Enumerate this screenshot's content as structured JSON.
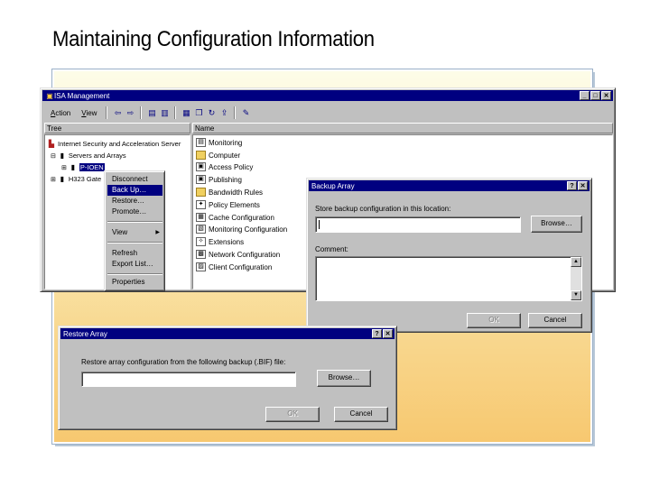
{
  "slide": {
    "title": "Maintaining Configuration Information"
  },
  "isa_window": {
    "title": "ISA Management",
    "menu": [
      {
        "first": "A",
        "rest": "ction"
      },
      {
        "first": "V",
        "rest": "iew"
      }
    ],
    "tree_header": "Tree",
    "tree": [
      {
        "label": "Internet Security and Acceleration Server",
        "icon": "isa-server-icon"
      },
      {
        "label": "Servers and Arrays",
        "icon": "servers-icon"
      },
      {
        "label": "P-IOEN",
        "icon": "array-icon",
        "selected": true
      },
      {
        "label": "H323 Gate",
        "icon": "gatekeeper-icon"
      }
    ],
    "list_header": "Name",
    "list": [
      {
        "label": "Monitoring",
        "icon": "monitoring-icon"
      },
      {
        "label": "Computer",
        "icon": "folder-icon"
      },
      {
        "label": "Access Policy",
        "icon": "access-policy-icon"
      },
      {
        "label": "Publishing",
        "icon": "publishing-icon"
      },
      {
        "label": "Bandwidth Rules",
        "icon": "folder-icon"
      },
      {
        "label": "Policy Elements",
        "icon": "policy-elements-icon"
      },
      {
        "label": "Cache Configuration",
        "icon": "cache-icon"
      },
      {
        "label": "Monitoring Configuration",
        "icon": "monitoring-config-icon"
      },
      {
        "label": "Extensions",
        "icon": "extensions-icon"
      },
      {
        "label": "Network Configuration",
        "icon": "network-icon"
      },
      {
        "label": "Client Configuration",
        "icon": "client-icon"
      }
    ]
  },
  "context_menu": {
    "items": [
      "Disconnect",
      "Back Up…",
      "Restore…",
      "Promote…",
      "View",
      "Refresh",
      "Export List…",
      "Properties"
    ],
    "selected": "Back Up…"
  },
  "backup_dialog": {
    "title": "Backup Array",
    "location_label": "Store backup configuration in this location:",
    "location_value": "",
    "browse": "Browse…",
    "comment_label": "Comment:",
    "comment_value": "",
    "ok": "OK",
    "cancel": "Cancel"
  },
  "restore_dialog": {
    "title": "Restore Array",
    "prompt": "Restore array configuration from the following backup (.BIF) file:",
    "file_value": "",
    "browse": "Browse…",
    "ok": "OK",
    "cancel": "Cancel"
  },
  "colors": {
    "titlebar": "#000080",
    "face": "#c0c0c0",
    "backdrop_top": "#fdfce8",
    "backdrop_bottom": "#f7c870"
  }
}
